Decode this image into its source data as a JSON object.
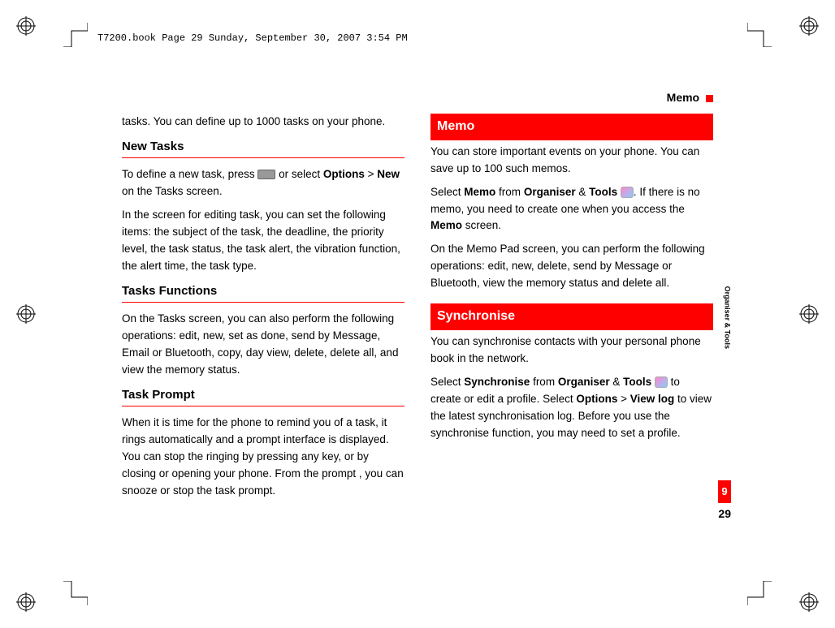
{
  "header_line": "T7200.book  Page 29  Sunday, September 30, 2007  3:54 PM",
  "running_head": "Memo",
  "side_label": "Organiser & Tools",
  "side_tab": "9",
  "page_number": "29",
  "col1": {
    "p1": "tasks. You can define up to 1000 tasks on your phone.",
    "h1": "New Tasks",
    "p2a": "To define a new task, press ",
    "p2b": " or select ",
    "p2_options": "Options",
    "p2_gt": " > ",
    "p2_new": "New",
    "p2c": " on the Tasks screen.",
    "p3": "In the screen for editing task, you can set the following items: the subject of the task, the deadline, the priority level, the task status, the task alert, the vibration function, the alert time, the task type.",
    "h2": "Tasks  Functions",
    "p4": "On the Tasks screen, you can also perform the following operations: edit, new, set as done, send by Message, Email or Bluetooth, copy, day view, delete, delete all, and view the memory status.",
    "h3": "Task Prompt",
    "p5": "When it is time for the phone to remind you of a task, it rings automatically and a prompt interface is displayed. You can stop the ringing by pressing any key, or by closing or opening your phone. From the prompt , you can snooze or stop the task prompt."
  },
  "col2": {
    "bar1": "Memo",
    "p1": "You can store important events on your phone. You can save up to 100 such memos.",
    "p2a": "Select ",
    "p2_memo": "Memo",
    "p2b": " from ",
    "p2_org": "Organiser",
    "p2_amp": " & ",
    "p2_tools": "Tools",
    "p2c": ". If there is no memo, you need to create one when you access the ",
    "p2_memo2": "Memo",
    "p2d": " screen.",
    "p3": "On the Memo Pad screen, you can perform the following operations: edit, new, delete, send by Message or Bluetooth, view the memory status and delete all.",
    "bar2": "Synchronise",
    "p4": "You can synchronise contacts with your personal phone book in the network.",
    "p5a": "Select ",
    "p5_sync": "Synchronise",
    "p5b": " from ",
    "p5_org": "Organiser",
    "p5_amp": " & ",
    "p5_tools": "Tools",
    "p5c": " to create or edit a profile. Select ",
    "p5_options": "Options",
    "p5_gt": " > ",
    "p5_viewlog": "View log",
    "p5d": " to view the latest synchronisation log. Before you use the synchronise function, you may need to set a profile."
  }
}
